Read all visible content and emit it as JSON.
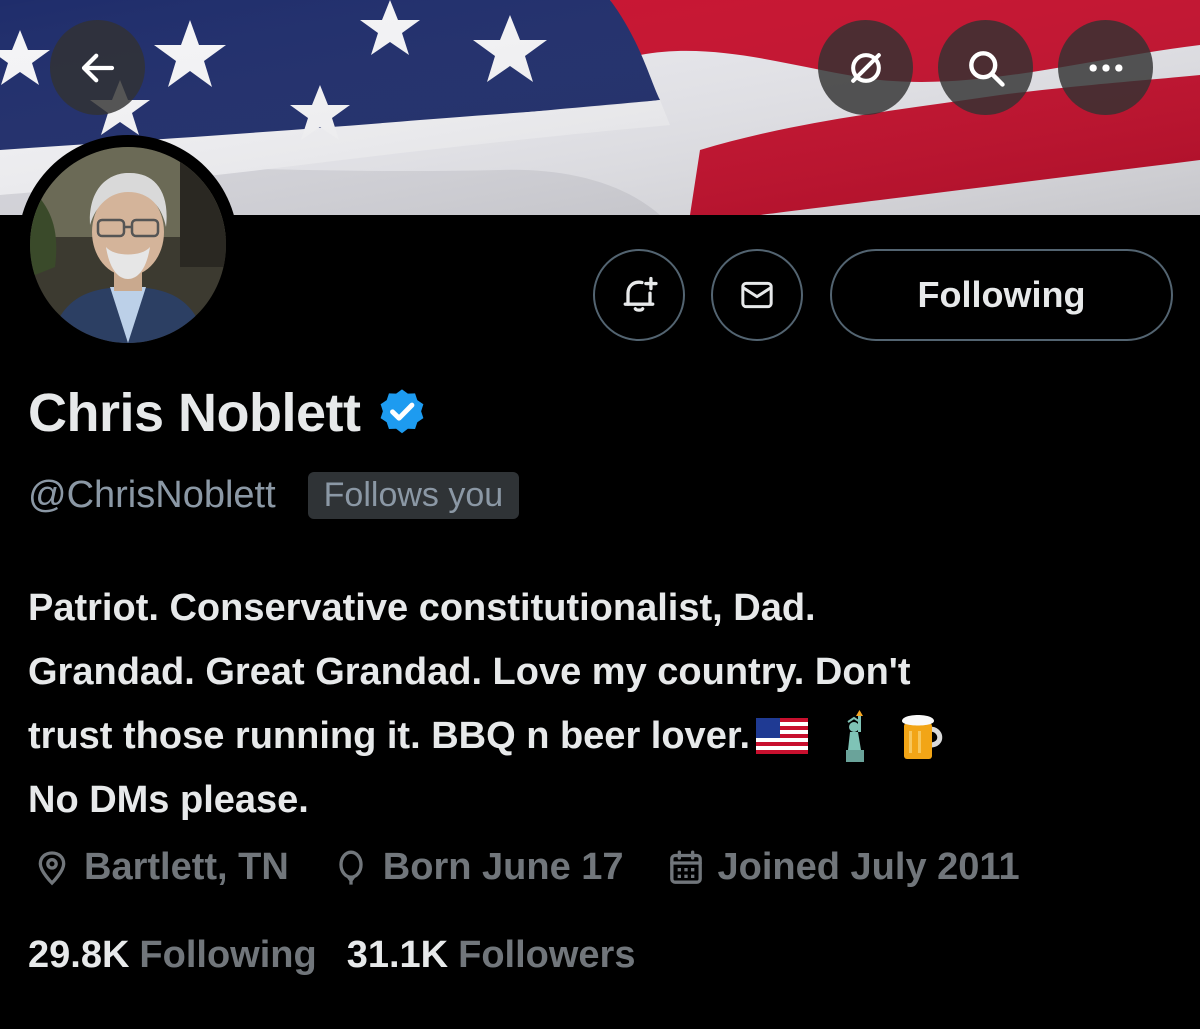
{
  "header": {
    "back_icon": "arrow-left-icon",
    "grok_icon": "grok-icon",
    "search_icon": "search-icon",
    "more_icon": "more-horizontal-icon"
  },
  "profile": {
    "name": "Chris Noblett",
    "handle": "@ChrisNoblett",
    "follows_you": "Follows you",
    "verified": true,
    "bio_lines": [
      "Patriot. Conservative constitutionalist, Dad.",
      "Grandad. Great Grandad. Love my country. Don't",
      "trust those running it. BBQ n beer lover.",
      "No DMs please."
    ],
    "bio_emojis": [
      "us-flag-emoji",
      "statue-of-liberty-emoji",
      "beer-mug-emoji"
    ],
    "location": "Bartlett, TN",
    "birthday": "Born June 17",
    "joined": "Joined July 2011",
    "following_count": "29.8K",
    "following_label": "Following",
    "followers_count": "31.1K",
    "followers_label": "Followers"
  },
  "actions": {
    "notify_icon": "bell-plus-icon",
    "message_icon": "envelope-icon",
    "follow_button": "Following"
  },
  "colors": {
    "background": "#000000",
    "text_primary": "#e7e9ea",
    "text_secondary": "#71767b",
    "verified_blue": "#1d9bf0",
    "border": "#536471"
  }
}
